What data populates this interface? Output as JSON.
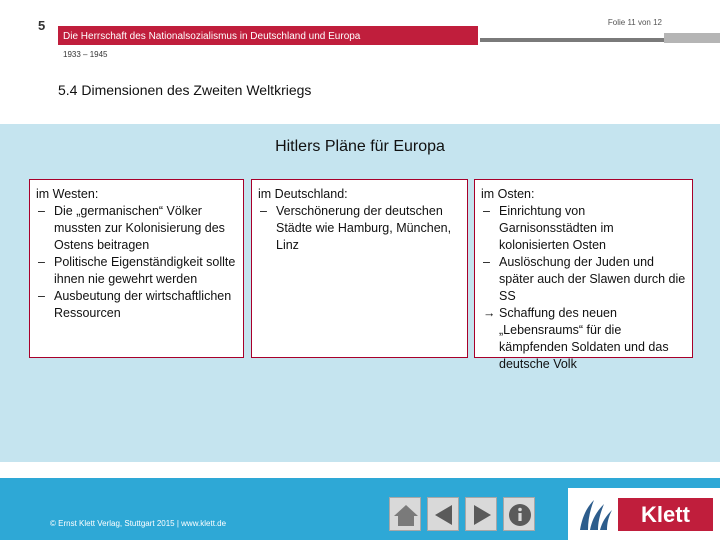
{
  "header": {
    "chapter_number": "5",
    "slide_counter": "Folie 11 von 12",
    "title": "Die Herrschaft des Nationalsozialismus in Deutschland und Europa",
    "years": "1933 – 1945",
    "section": "5.4 Dimensionen des Zweiten Weltkriegs"
  },
  "main": {
    "title": "Hitlers Pläne für Europa",
    "west": {
      "heading": "im Westen:",
      "items": [
        {
          "mark": "–",
          "text": "Die „germanischen“ Völker mussten zur Kolonisierung des Ostens beitragen"
        },
        {
          "mark": "–",
          "text": "Politische Eigenständigkeit sollte ihnen nie gewehrt werden"
        },
        {
          "mark": "–",
          "text": "Ausbeutung der wirtschaftlichen Ressourcen"
        }
      ]
    },
    "germany": {
      "heading": "im Deutschland:",
      "items": [
        {
          "mark": "–",
          "text": "Verschönerung der deutschen Städte wie Hamburg, München, Linz"
        }
      ]
    },
    "east": {
      "heading": "im Osten:",
      "items": [
        {
          "mark": "–",
          "text": "Einrichtung von Garnisonsstädten im kolonisierten Osten"
        },
        {
          "mark": "–",
          "text": "Auslöschung der Juden und später auch der Slawen durch die SS"
        },
        {
          "mark": "→",
          "text": "Schaffung des neuen „Lebensraums“ für die kämpfenden Soldaten und das deutsche Volk"
        }
      ]
    }
  },
  "footer": {
    "copyright": "© Ernst Klett Verlag, Stuttgart 2015 | www.klett.de",
    "logo_text": "Klett",
    "icons": [
      "home-icon",
      "prev-arrow-icon",
      "next-arrow-icon",
      "info-icon"
    ]
  },
  "colors": {
    "brand_red": "#c01e3c",
    "panel_blue": "#c5e4ef",
    "footer_blue": "#2ea8d6",
    "box_border": "#a8002a"
  }
}
